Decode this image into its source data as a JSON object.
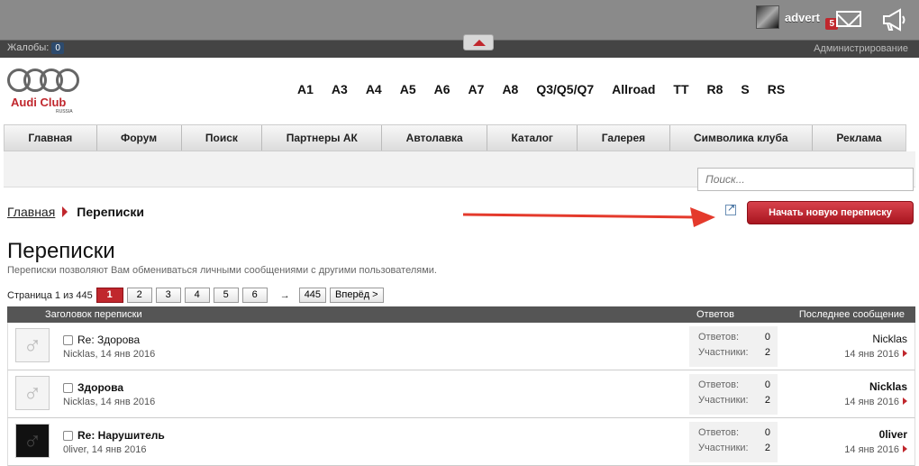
{
  "topbar": {
    "username": "advert",
    "mail_count": "5",
    "avatar_icon": "user-avatar",
    "mail_icon": "envelope-icon",
    "announce_icon": "megaphone-icon"
  },
  "subbar": {
    "complaints_label": "Жалобы:",
    "complaints_count": "0",
    "admin_label": "Администрирование"
  },
  "logo": {
    "brand": "Audi Club",
    "sub": "RUSSIA"
  },
  "models": [
    "A1",
    "A3",
    "A4",
    "A5",
    "A6",
    "A7",
    "A8",
    "Q3/Q5/Q7",
    "Allroad",
    "TT",
    "R8",
    "S",
    "RS"
  ],
  "nav": [
    "Главная",
    "Форум",
    "Поиск",
    "Партнеры АК",
    "Автолавка",
    "Каталог",
    "Галерея",
    "Символика клуба",
    "Реклама"
  ],
  "search": {
    "placeholder": "Поиск..."
  },
  "breadcrumb": {
    "home": "Главная",
    "current": "Переписки"
  },
  "actions": {
    "new_conversation": "Начать новую переписку"
  },
  "page": {
    "title": "Переписки",
    "description": "Переписки позволяют Вам обмениваться личными сообщениями с другими пользователями."
  },
  "pager": {
    "label": "Страница 1 из 445",
    "pages": [
      "1",
      "2",
      "3",
      "4",
      "5",
      "6"
    ],
    "last": "445",
    "next": "Вперёд >",
    "arrow": "→"
  },
  "table": {
    "col_title": "Заголовок переписки",
    "col_replies": "Ответов",
    "col_last": "Последнее сообщение",
    "replies_label": "Ответов:",
    "participants_label": "Участники:",
    "rows": [
      {
        "title": "Re: Здорова",
        "author": "Nicklas, 14 янв 2016",
        "replies": "0",
        "participants": "2",
        "last_user": "Nicklas",
        "last_date": "14 янв 2016"
      },
      {
        "title": "Здорова",
        "author": "Nicklas, 14 янв 2016",
        "replies": "0",
        "participants": "2",
        "last_user": "Nicklas",
        "last_date": "14 янв 2016"
      },
      {
        "title": "Re: Нарушитель",
        "author": "0liver, 14 янв 2016",
        "replies": "0",
        "participants": "2",
        "last_user": "0liver",
        "last_date": "14 янв 2016"
      }
    ]
  },
  "colors": {
    "accent": "#c0272d",
    "topbar": "#8a8a8a",
    "subbar": "#444444"
  }
}
